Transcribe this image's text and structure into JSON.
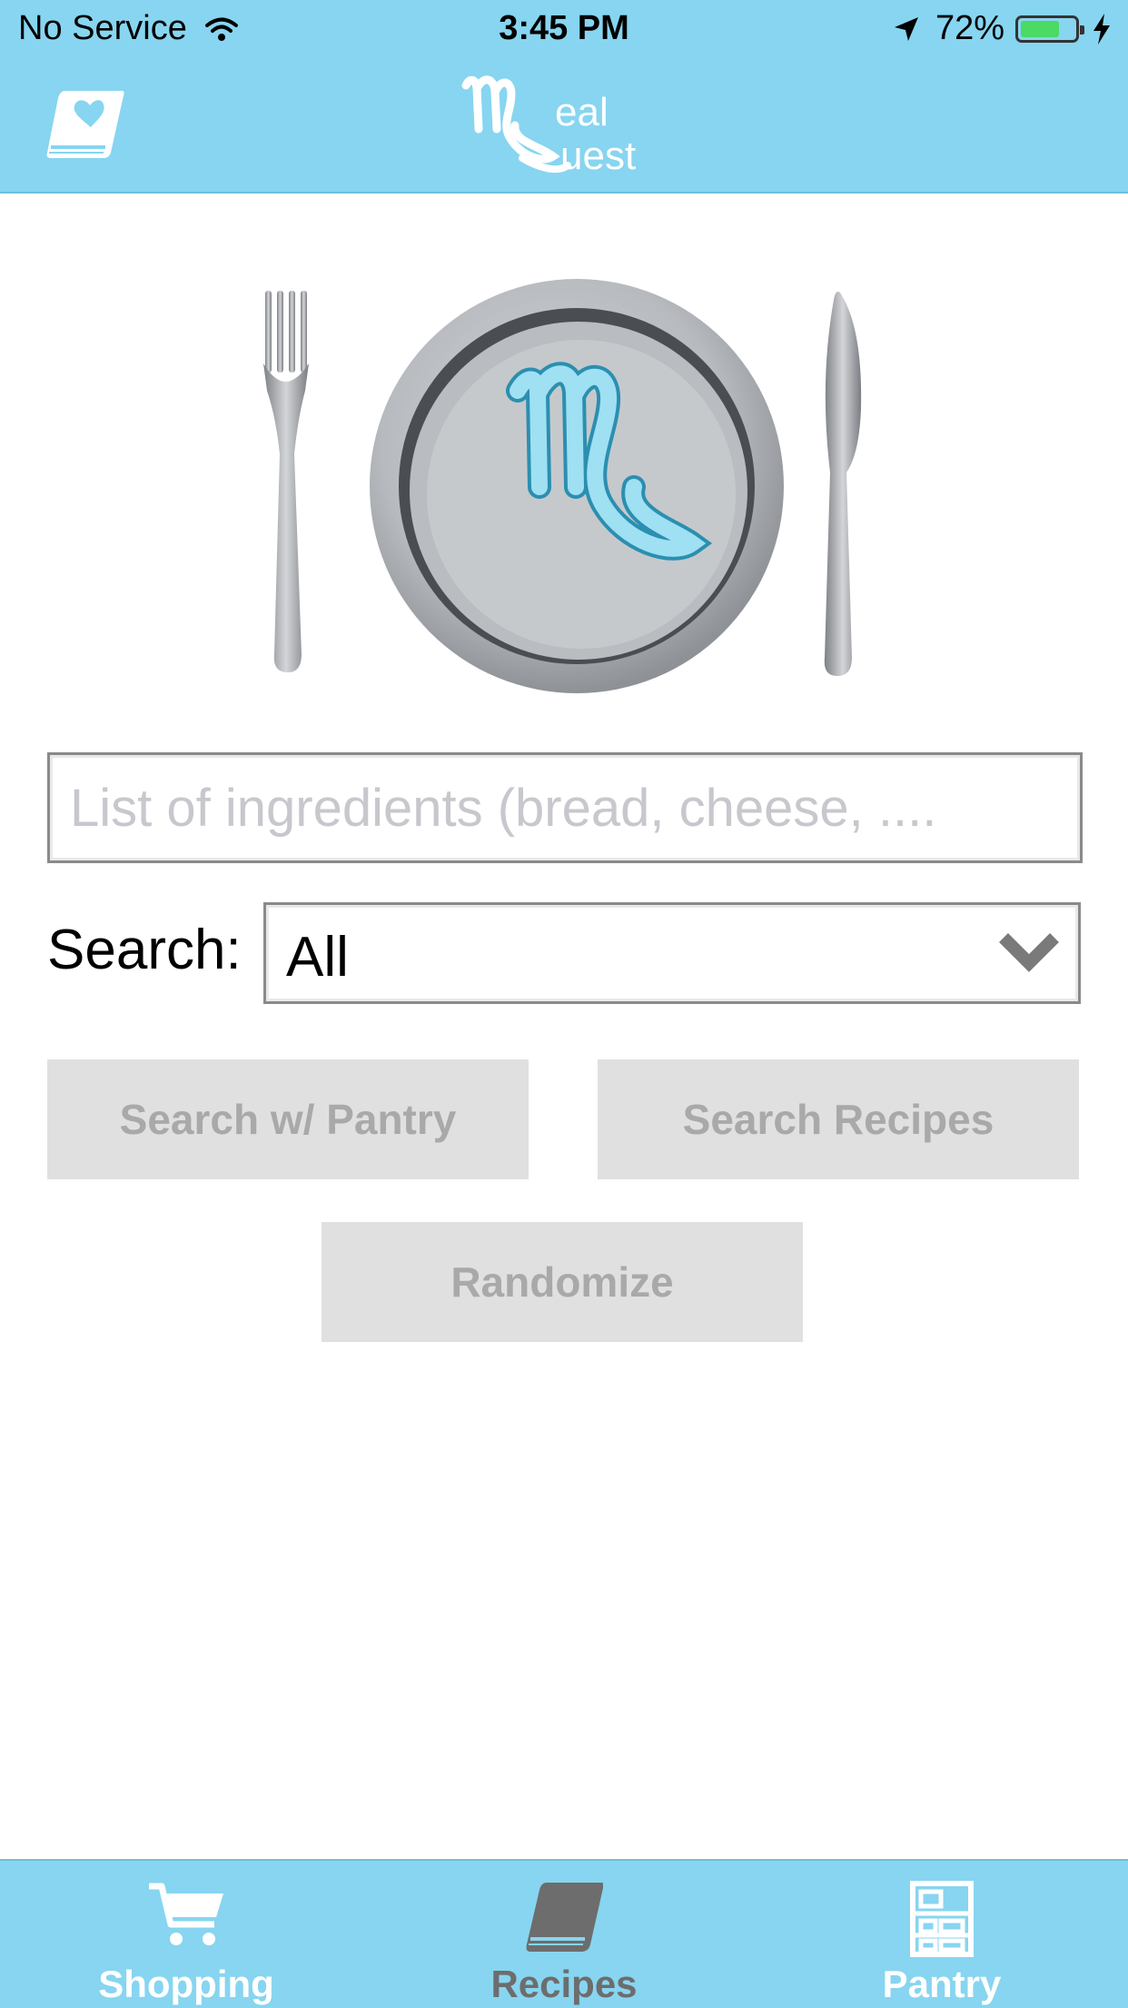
{
  "status_bar": {
    "carrier": "No Service",
    "time": "3:45 PM",
    "battery_percent": "72%",
    "battery_level": 0.72
  },
  "nav": {
    "logo_text": "Meal Quest"
  },
  "ingredients_input": {
    "placeholder": "List of ingredients (bread, cheese, ....",
    "value": ""
  },
  "search": {
    "label": "Search:",
    "selected": "All"
  },
  "buttons": {
    "search_pantry": "Search w/ Pantry",
    "search_recipes": "Search Recipes",
    "randomize": "Randomize"
  },
  "tabs": [
    {
      "label": "Shopping",
      "icon": "cart-icon",
      "active": false
    },
    {
      "label": "Recipes",
      "icon": "book-icon",
      "active": true
    },
    {
      "label": "Pantry",
      "icon": "pantry-shelf-icon",
      "active": false
    }
  ],
  "colors": {
    "bar_blue": "#87d5f0",
    "button_gray": "#e0e0e0",
    "button_text": "#a9a9a9",
    "active_tab": "#6d6d6d"
  }
}
